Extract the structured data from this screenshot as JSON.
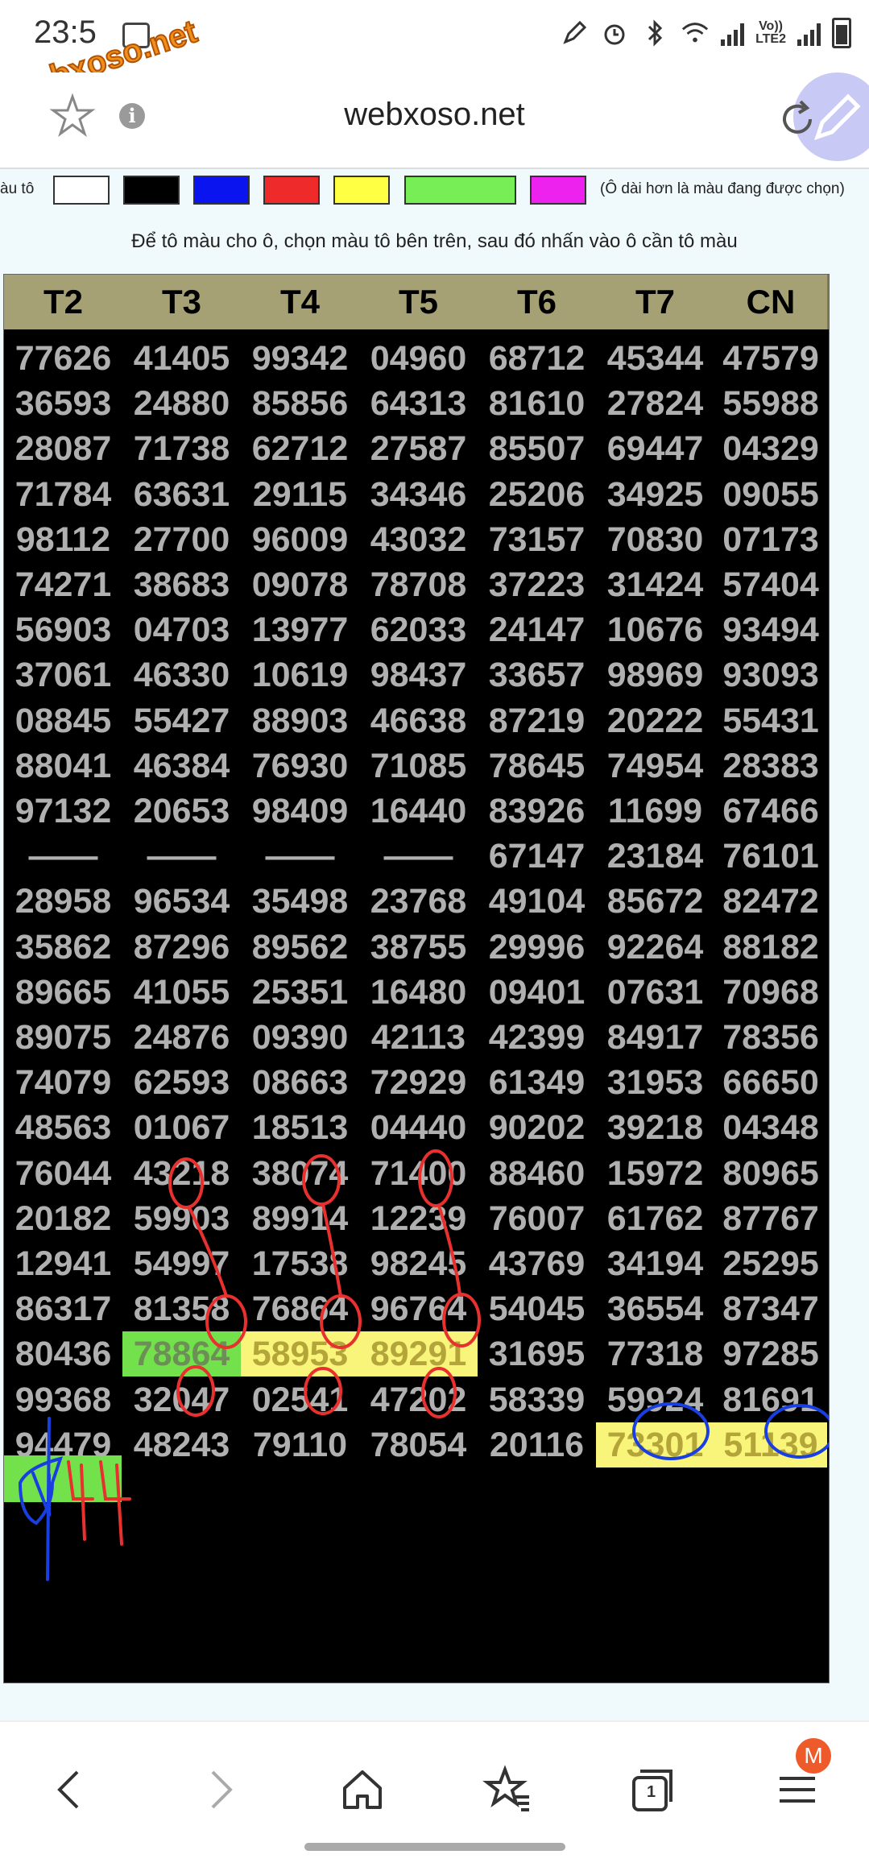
{
  "status_bar": {
    "time": "23:5",
    "network_label": "VoLTE2",
    "network_line1": "Vo))",
    "network_line2": "LTE2"
  },
  "watermark": "webxoso.net",
  "browser": {
    "site_title": "webxoso.net"
  },
  "palette": {
    "label_partial": "àu tô",
    "note": "(Ô dài hơn là màu đang được chọn)",
    "colors": [
      "#ffffff",
      "#000000",
      "#0000ff",
      "#ee2a2a",
      "#ffff44",
      "#77ee55",
      "#ee22ee"
    ]
  },
  "instruction": "Để tô màu cho ô, chọn màu tô bên trên, sau đó nhấn vào ô cần tô màu",
  "table": {
    "headers": [
      "T2",
      "T3",
      "T4",
      "T5",
      "T6",
      "T7",
      "CN"
    ],
    "rows": [
      [
        "77626",
        "41405",
        "99342",
        "04960",
        "68712",
        "45344",
        "47579"
      ],
      [
        "36593",
        "24880",
        "85856",
        "64313",
        "81610",
        "27824",
        "55988"
      ],
      [
        "28087",
        "71738",
        "62712",
        "27587",
        "85507",
        "69447",
        "04329"
      ],
      [
        "71784",
        "63631",
        "29115",
        "34346",
        "25206",
        "34925",
        "09055"
      ],
      [
        "98112",
        "27700",
        "96009",
        "43032",
        "73157",
        "70830",
        "07173"
      ],
      [
        "74271",
        "38683",
        "09078",
        "78708",
        "37223",
        "31424",
        "57404"
      ],
      [
        "56903",
        "04703",
        "13977",
        "62033",
        "24147",
        "10676",
        "93494"
      ],
      [
        "37061",
        "46330",
        "10619",
        "98437",
        "33657",
        "98969",
        "93093"
      ],
      [
        "08845",
        "55427",
        "88903",
        "46638",
        "87219",
        "20222",
        "55431"
      ],
      [
        "88041",
        "46384",
        "76930",
        "71085",
        "78645",
        "74954",
        "28383"
      ],
      [
        "97132",
        "20653",
        "98409",
        "16440",
        "83926",
        "11699",
        "67466"
      ],
      [
        "——",
        "——",
        "——",
        "——",
        "67147",
        "23184",
        "76101"
      ],
      [
        "28958",
        "96534",
        "35498",
        "23768",
        "49104",
        "85672",
        "82472"
      ],
      [
        "35862",
        "87296",
        "89562",
        "38755",
        "29996",
        "92264",
        "88182"
      ],
      [
        "89665",
        "41055",
        "25351",
        "16480",
        "09401",
        "07631",
        "70968"
      ],
      [
        "89075",
        "24876",
        "09390",
        "42113",
        "42399",
        "84917",
        "78356"
      ],
      [
        "74079",
        "62593",
        "08663",
        "72929",
        "61349",
        "31953",
        "66650"
      ],
      [
        "48563",
        "01067",
        "18513",
        "04440",
        "90202",
        "39218",
        "04348"
      ],
      [
        "76044",
        "43218",
        "38074",
        "71400",
        "88460",
        "15972",
        "80965"
      ],
      [
        "20182",
        "59903",
        "89914",
        "12239",
        "76007",
        "61762",
        "87767"
      ],
      [
        "12941",
        "54997",
        "17538",
        "98245",
        "43769",
        "34194",
        "25295"
      ],
      [
        "86317",
        "81358",
        "76864",
        "96764",
        "54045",
        "36554",
        "87347"
      ],
      [
        "80436",
        "78864",
        "58953",
        "89291",
        "31695",
        "77318",
        "97285"
      ],
      [
        "99368",
        "32047",
        "02541",
        "47202",
        "58339",
        "59924",
        "81691"
      ],
      [
        "94479",
        "48243",
        "79110",
        "78054",
        "20116",
        "73301",
        "51139"
      ]
    ],
    "highlights": {
      "22-1": "green",
      "22-2": "yellow",
      "22-3": "yellow",
      "24-5": "yellow",
      "24-6": "yellow"
    },
    "handwritten_note": "0|44"
  },
  "bottom_nav": {
    "tab_count": "1",
    "profile_badge": "M"
  }
}
